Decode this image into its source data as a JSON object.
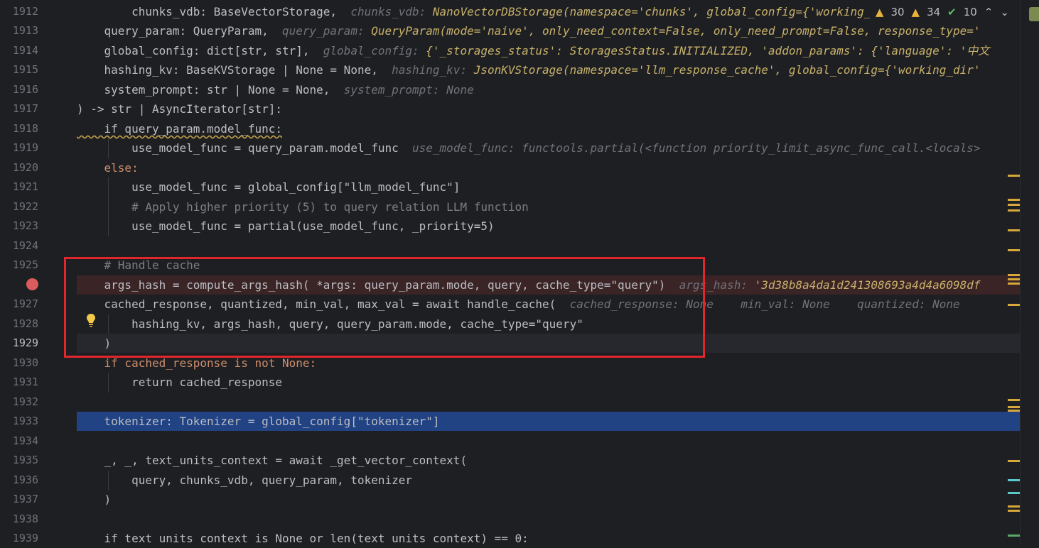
{
  "status": {
    "warnings_count": "30",
    "weak_warnings_count": "34",
    "ok_count": "10",
    "up_icon": "chevron-up-icon",
    "down_icon": "chevron-down-icon"
  },
  "lines": [
    {
      "n": "1912",
      "a": "    chunks_vdb: BaseVectorStorage,",
      "h1": "  chunks_vdb: ",
      "h2": "NanoVectorDBStorage(namespace='chunks', global_config={'working_"
    },
    {
      "n": "1913",
      "a": "    query_param: QueryParam,",
      "h1": "  query_param: ",
      "h2": "QueryParam(mode='naive', only_need_context=False, only_need_prompt=False, response_type='"
    },
    {
      "n": "1914",
      "a": "    global_config: dict[str, str],",
      "h1": "  global_config: ",
      "h2": "{'_storages_status': StoragesStatus.INITIALIZED, 'addon_params': {'language': '中文"
    },
    {
      "n": "1915",
      "a": "    hashing_kv: BaseKVStorage | None = None,",
      "h1": "  hashing_kv: ",
      "h2": "JsonKVStorage(namespace='llm_response_cache', global_config={'working_dir'"
    },
    {
      "n": "1916",
      "a": "    system_prompt: str | None = None,",
      "h1": "  system_prompt: ",
      "h2": "None"
    },
    {
      "n": "1917",
      "a": ") -> str | AsyncIterator[str]:",
      "h1": "",
      "h2": ""
    },
    {
      "n": "1918",
      "a": "    if query_param.model_func:",
      "h1": "",
      "h2": ""
    },
    {
      "n": "1919",
      "a": "        use_model_func = query_param.model_func",
      "h1": "  use_model_func: ",
      "h2": "functools.partial(<function priority_limit_async_func_call.<locals>"
    },
    {
      "n": "1920",
      "a": "    else:",
      "h1": "",
      "h2": ""
    },
    {
      "n": "1921",
      "a": "        use_model_func = global_config[\"llm_model_func\"]",
      "h1": "",
      "h2": ""
    },
    {
      "n": "1922",
      "a": "        # Apply higher priority (5) to query relation LLM function",
      "h1": "",
      "h2": ""
    },
    {
      "n": "1923",
      "a": "        use_model_func = partial(use_model_func, _priority=5)",
      "h1": "",
      "h2": ""
    },
    {
      "n": "1924",
      "a": "",
      "h1": "",
      "h2": ""
    },
    {
      "n": "1925",
      "a": "    # Handle cache",
      "h1": "",
      "h2": ""
    },
    {
      "n": "",
      "a": "    args_hash = compute_args_hash( *args: query_param.mode, query, cache_type=\"query\")",
      "h1": "  args_hash: ",
      "h2": "'3d38b8a4da1d241308693a4d4a6098df"
    },
    {
      "n": "1927",
      "a": "    cached_response, quantized, min_val, max_val = await handle_cache(",
      "h1": "  cached_response: None    min_val: None    quantized: None",
      "h2": ""
    },
    {
      "n": "1928",
      "a": "        hashing_kv, args_hash, query, query_param.mode, cache_type=\"query\"",
      "h1": "",
      "h2": ""
    },
    {
      "n": "1929",
      "a": "    )",
      "h1": "",
      "h2": ""
    },
    {
      "n": "1930",
      "a": "    if cached_response is not None:",
      "h1": "",
      "h2": ""
    },
    {
      "n": "1931",
      "a": "        return cached_response",
      "h1": "",
      "h2": ""
    },
    {
      "n": "1932",
      "a": "",
      "h1": "",
      "h2": ""
    },
    {
      "n": "1933",
      "a": "    tokenizer: Tokenizer = global_config[\"tokenizer\"]",
      "h1": "",
      "h2": ""
    },
    {
      "n": "1934",
      "a": "",
      "h1": "",
      "h2": ""
    },
    {
      "n": "1935",
      "a": "    _, _, text_units_context = await _get_vector_context(",
      "h1": "",
      "h2": ""
    },
    {
      "n": "1936",
      "a": "        query, chunks_vdb, query_param, tokenizer",
      "h1": "",
      "h2": ""
    },
    {
      "n": "1937",
      "a": "    )",
      "h1": "",
      "h2": ""
    },
    {
      "n": "1938",
      "a": "",
      "h1": "",
      "h2": ""
    },
    {
      "n": "1939",
      "a": "    if text_units_context is None or len(text_units_context) == 0:",
      "h1": "",
      "h2": ""
    }
  ]
}
